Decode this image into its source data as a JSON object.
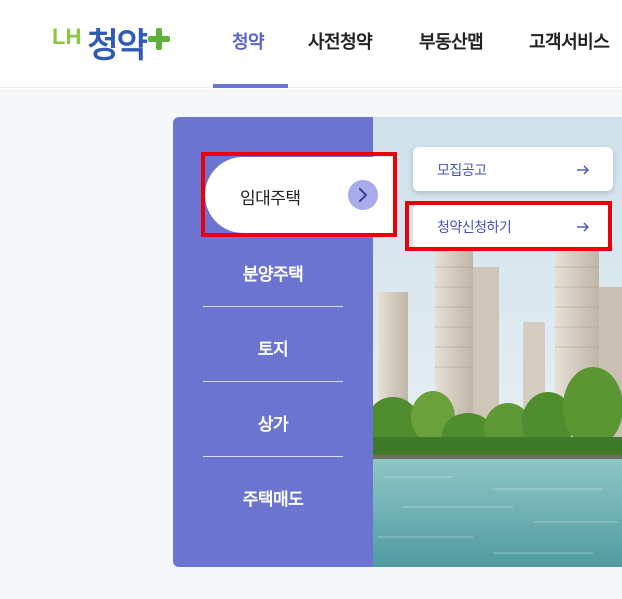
{
  "header": {
    "logo": {
      "prefix": "LH",
      "name": "청약"
    },
    "nav": [
      {
        "label": "청약",
        "active": true
      },
      {
        "label": "사전청약",
        "active": false
      },
      {
        "label": "부동산맵",
        "active": false
      },
      {
        "label": "고객서비스",
        "active": false
      }
    ]
  },
  "menu": {
    "active_item": "임대주택",
    "items": [
      "분양주택",
      "토지",
      "상가",
      "주택매도"
    ]
  },
  "submenu": {
    "items": [
      "모집공고",
      "청약신청하기"
    ]
  },
  "colors": {
    "accent": "#6b74d0",
    "nav_active": "#5b63c9",
    "logo_blue": "#2f5bb7",
    "logo_green": "#8cc63f",
    "highlight": "#e8000b"
  },
  "icons": {
    "menu_active_arrow": "chevron-right-icon",
    "submenu_arrow": "arrow-right-icon"
  }
}
